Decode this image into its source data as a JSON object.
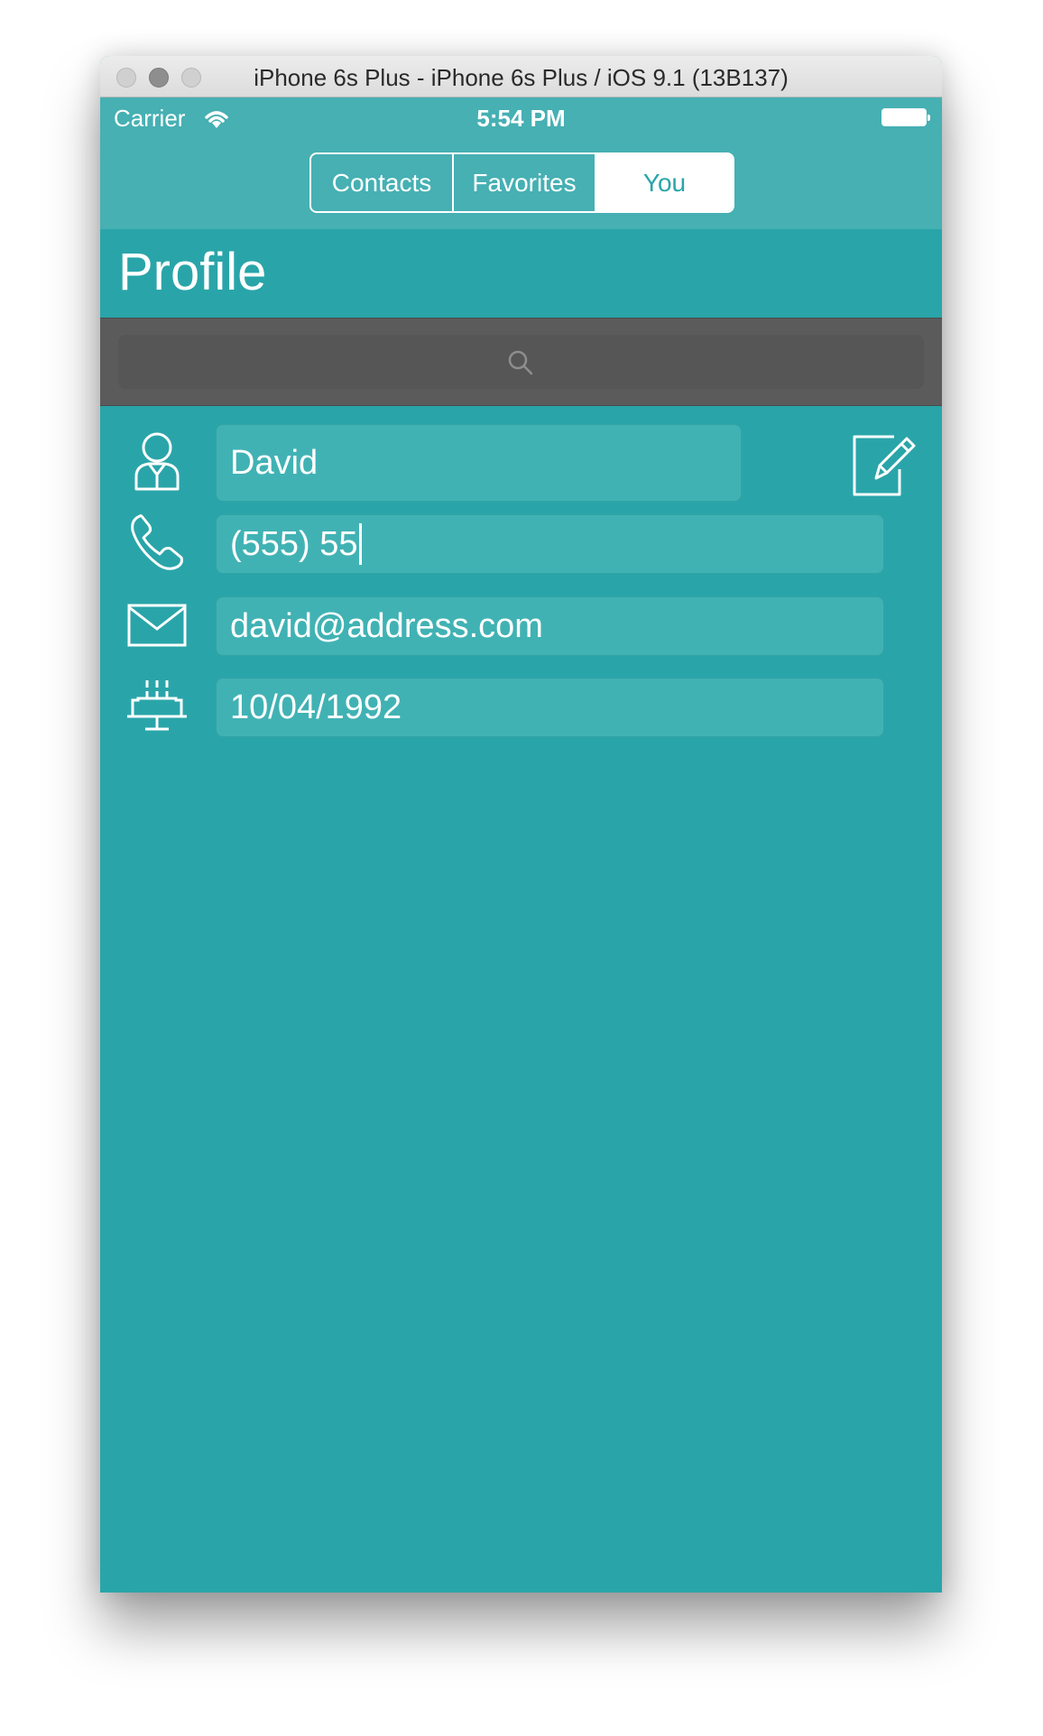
{
  "window": {
    "title": "iPhone 6s Plus - iPhone 6s Plus / iOS 9.1 (13B137)"
  },
  "status_bar": {
    "carrier": "Carrier",
    "time": "5:54 PM",
    "wifi_icon": "wifi-icon",
    "battery_icon": "battery-icon"
  },
  "segments": [
    {
      "label": "Contacts",
      "selected": false
    },
    {
      "label": "Favorites",
      "selected": false
    },
    {
      "label": "You",
      "selected": true
    }
  ],
  "page": {
    "title": "Profile"
  },
  "search": {
    "placeholder": "",
    "icon": "search-icon"
  },
  "profile": {
    "name": {
      "value": "David",
      "icon": "person-icon"
    },
    "phone": {
      "value": "(555) 55",
      "icon": "phone-icon"
    },
    "email": {
      "value": "david@address.com",
      "icon": "mail-icon"
    },
    "birthday": {
      "value": "10/04/1992",
      "icon": "birthday-cake-icon"
    },
    "edit_icon": "edit-icon"
  },
  "colors": {
    "primary": "#29a5a9",
    "header": "#46b0b3",
    "field": "#41b2b4",
    "search_bar": "#5b5b5b",
    "text": "#ffffff"
  }
}
